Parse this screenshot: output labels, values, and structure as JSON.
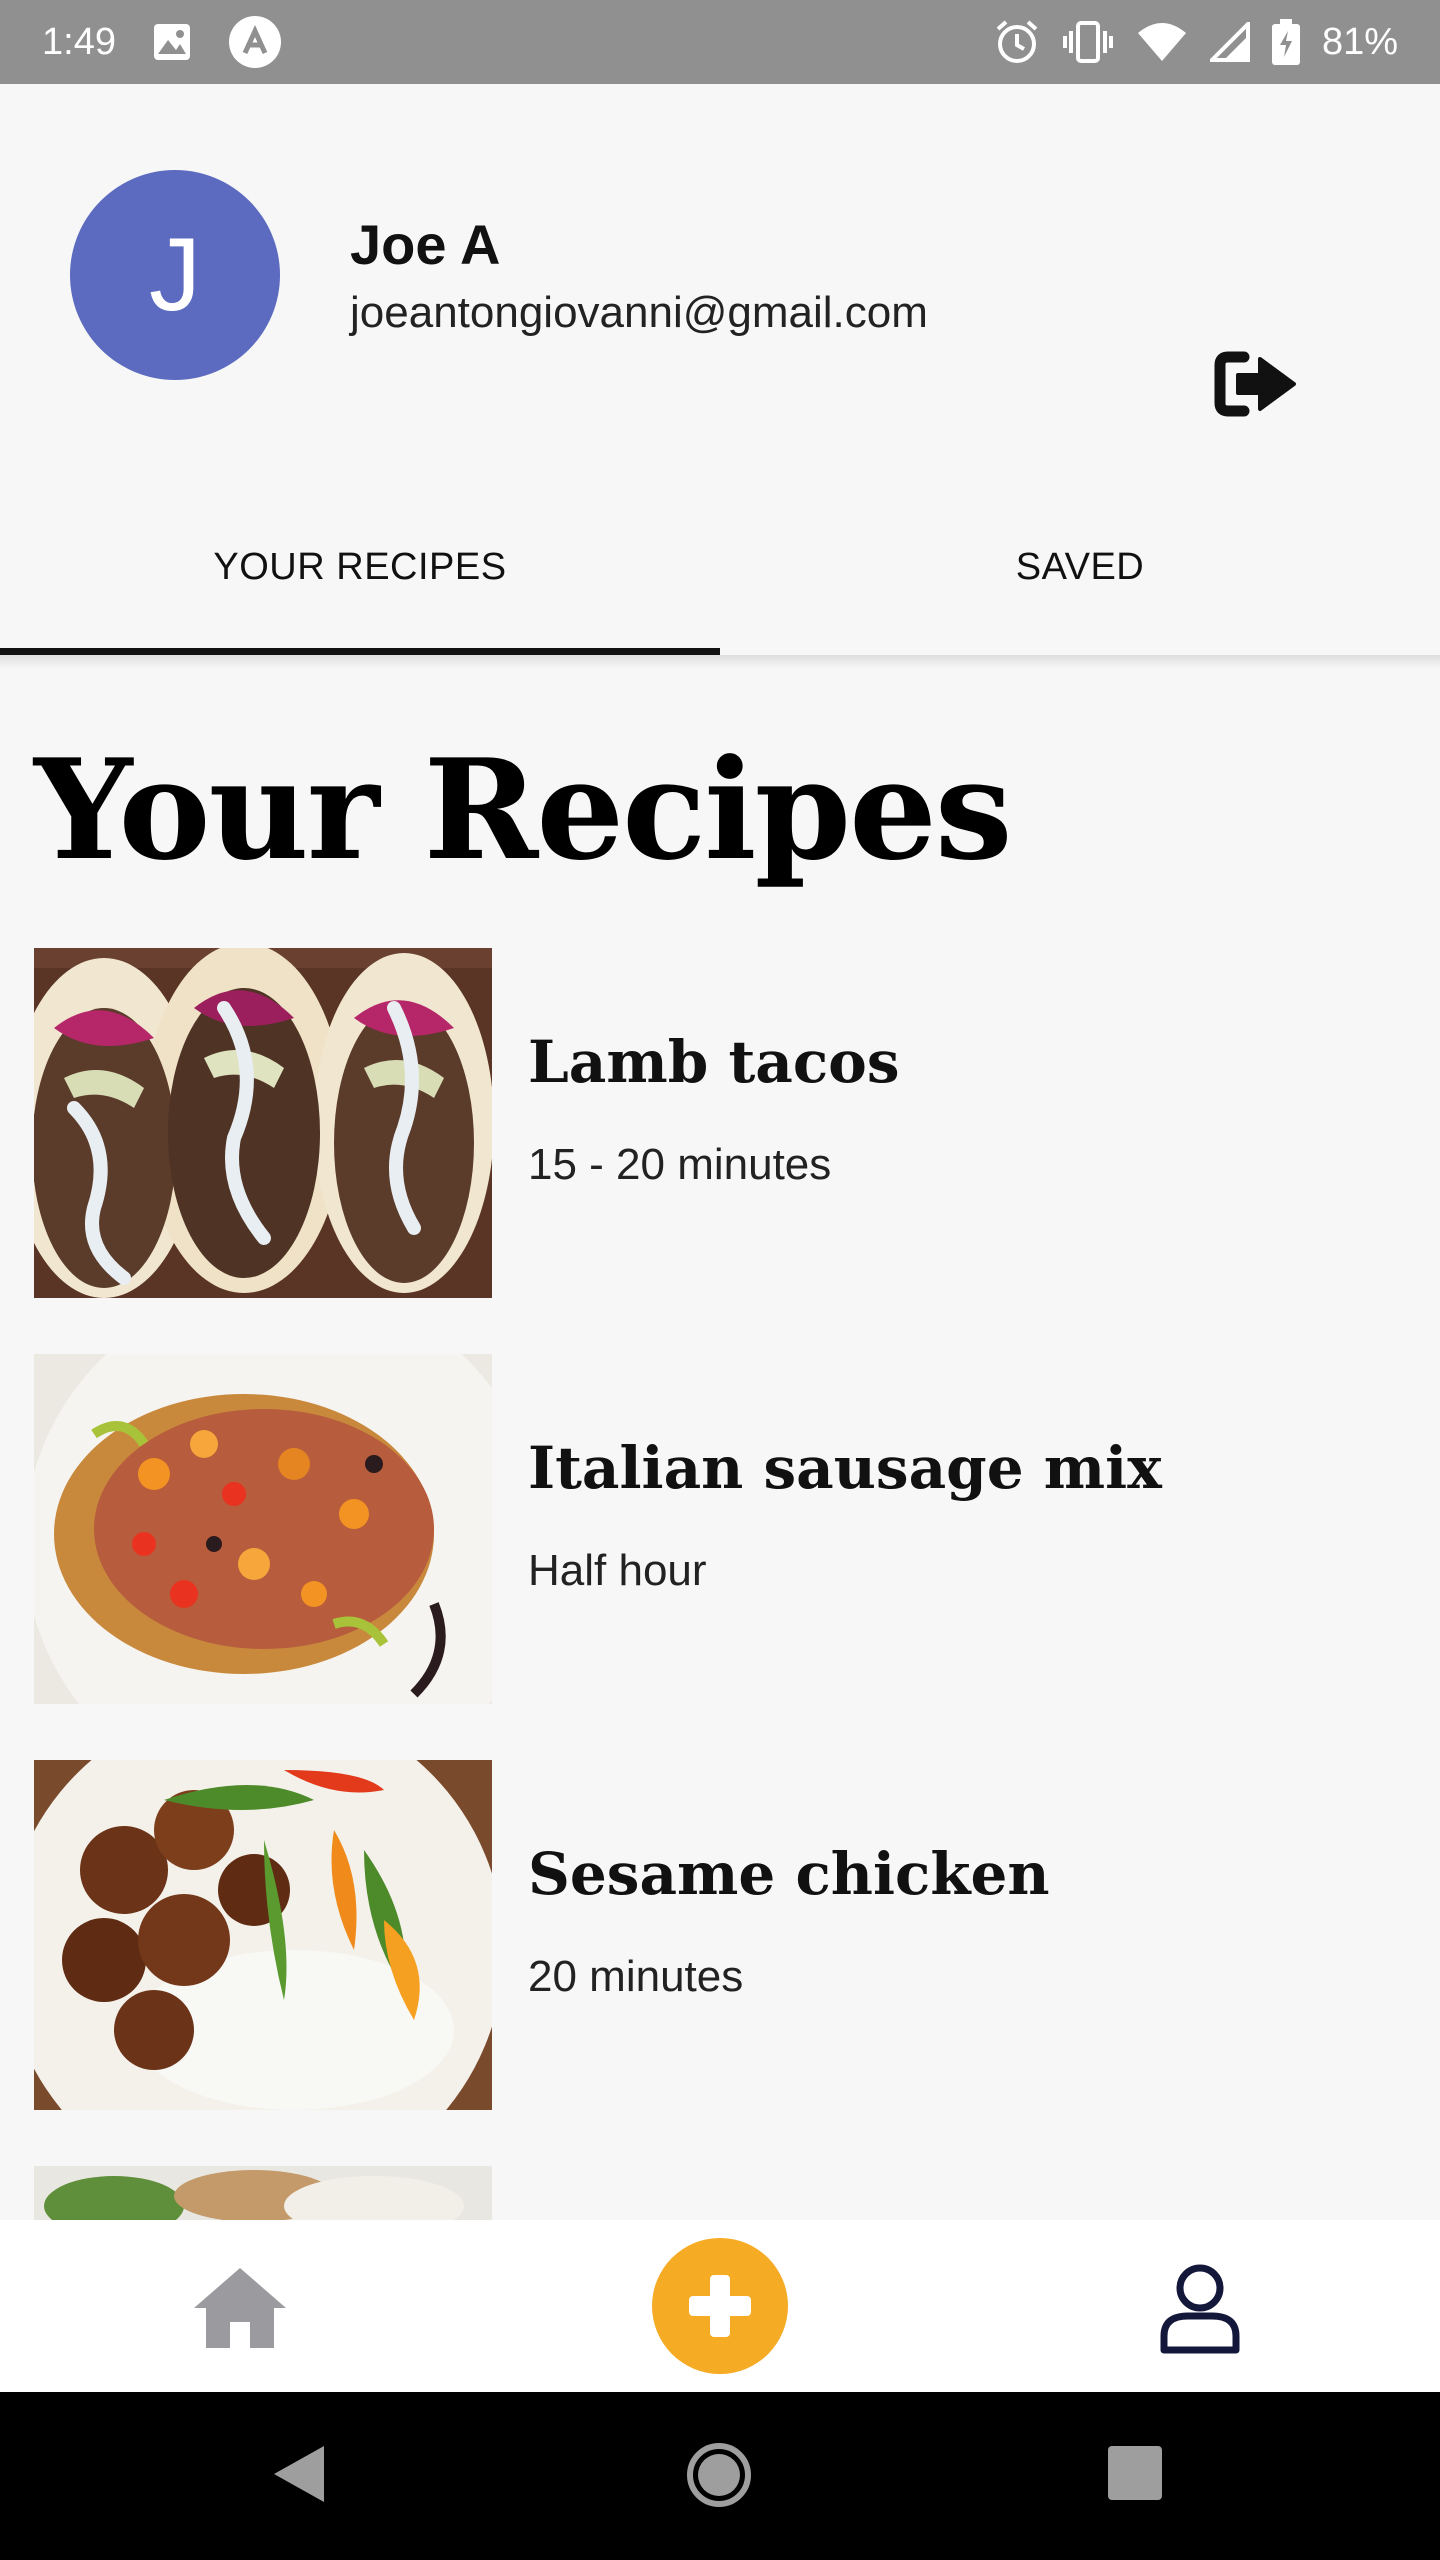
{
  "status_bar": {
    "time": "1:49",
    "battery": "81%",
    "icons": [
      "image-icon",
      "app-icon",
      "alarm-icon",
      "vibrate-icon",
      "wifi-icon",
      "signal-icon",
      "battery-charging-icon"
    ]
  },
  "profile": {
    "initial": "J",
    "name": "Joe A",
    "email": "joeantongiovanni@gmail.com",
    "avatar_color": "#5c6bc0",
    "logout_icon": "logout-icon"
  },
  "tabs": [
    {
      "label": "YOUR RECIPES",
      "active": true
    },
    {
      "label": "SAVED",
      "active": false
    }
  ],
  "page_title": "Your Recipes",
  "recipes": [
    {
      "title": "Lamb tacos",
      "time": "15 - 20 minutes"
    },
    {
      "title": "Italian sausage mix",
      "time": "Half hour"
    },
    {
      "title": "Sesame chicken",
      "time": "20 minutes"
    }
  ],
  "bottom_nav": {
    "items": [
      "home-icon",
      "add-icon",
      "profile-icon"
    ],
    "accent": "#f5ab24"
  },
  "system_nav": [
    "back-icon",
    "home-circle-icon",
    "recents-icon"
  ]
}
